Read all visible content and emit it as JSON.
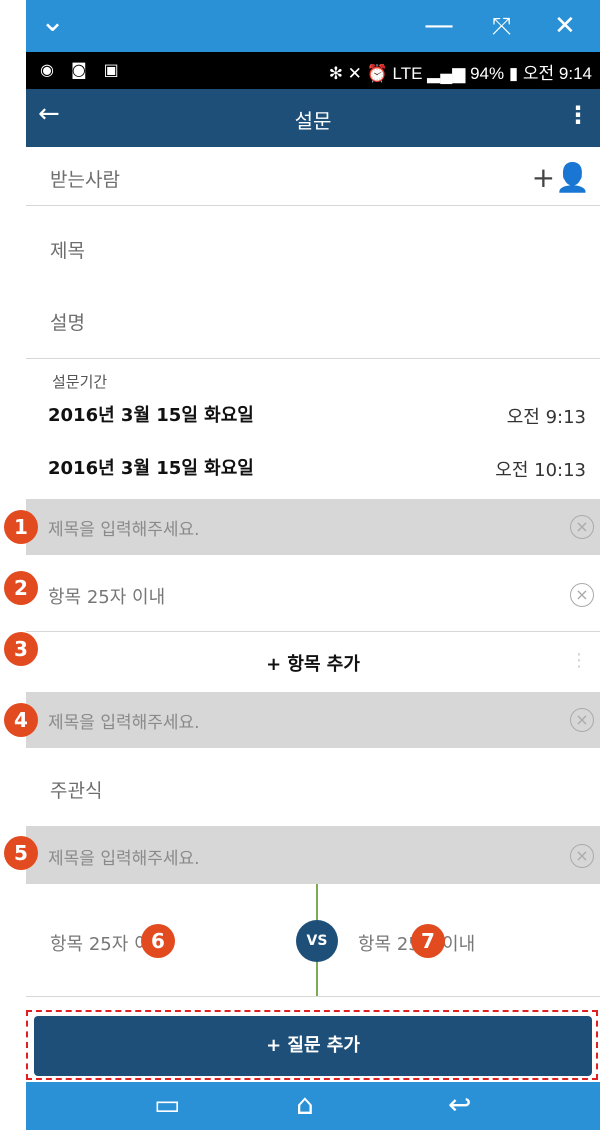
{
  "window_chrome": {
    "collapse_icon": "⌄",
    "minimize_icon": "—",
    "fullscreen_icon": "⤧",
    "close_icon": "✕"
  },
  "status_bar": {
    "left_icons": "◉ ◙ ▣",
    "right_text": "✻ ✕ ⏰ LTE ▂▄▆ 94% ▮ 오전 9:14"
  },
  "app_bar": {
    "back": "←",
    "title": "설문",
    "more": "⋮"
  },
  "recipient": {
    "label": "받는사람",
    "add_icon": "+👤"
  },
  "fields": {
    "title_placeholder": "제목",
    "description_placeholder": "설명"
  },
  "period": {
    "label": "설문기간",
    "start_date": "2016년 3월 15일 화요일",
    "start_time": "오전 9:13",
    "end_date": "2016년 3월 15일 화요일",
    "end_time": "오전 10:13"
  },
  "questions": [
    {
      "badge": "1",
      "title_placeholder": "제목을 입력해주세요."
    },
    {
      "badge": "2",
      "item_placeholder": "항목 25자 이내"
    },
    {
      "badge": "3",
      "add_item": "+ 항목 추가"
    },
    {
      "badge": "4",
      "title_placeholder": "제목을 입력해주세요.",
      "type_label": "주관식"
    },
    {
      "badge": "5",
      "title_placeholder": "제목을 입력해주세요."
    }
  ],
  "versus": {
    "left_placeholder": "항목 25자 이내",
    "right_placeholder": "항목 25자 이내",
    "vs_label": "VS",
    "badge_left": "6",
    "badge_right": "7"
  },
  "add_question": "+ 질문 추가",
  "nav_bar": {
    "recent_icon": "▭",
    "home_icon": "⌂",
    "back_icon": "↩"
  },
  "colors": {
    "app_bar": "#1e4f79",
    "chrome": "#2a91d6",
    "badge": "#e24a1f",
    "vs_line": "#7dab55"
  }
}
